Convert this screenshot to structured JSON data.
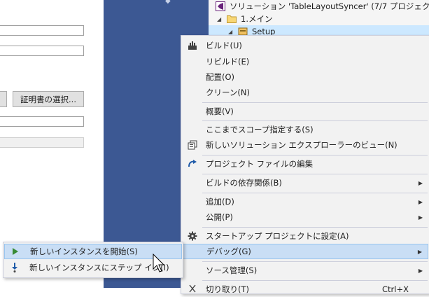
{
  "property_page": {
    "select_cert_label": "証明書の選択..."
  },
  "blue_glyph": "◆",
  "solution_explorer": {
    "solution_label": "ソリューション 'TableLayoutSyncer' (7/7 プロジェクト)",
    "folder_label": "1.メイン",
    "project_label": "Setup"
  },
  "context_menu": {
    "items": [
      {
        "label": "ビルド(U)",
        "icon": "build-icon"
      },
      {
        "label": "リビルド(E)"
      },
      {
        "label": "配置(O)"
      },
      {
        "label": "クリーン(N)"
      },
      {
        "label": "概要(V)"
      },
      {
        "label": "ここまでスコープ指定する(S)"
      },
      {
        "label": "新しいソリューション エクスプローラーのビュー(N)",
        "icon": "new-view-icon"
      },
      {
        "label": "プロジェクト ファイルの編集",
        "icon": "edit-project-icon"
      },
      {
        "label": "ビルドの依存関係(B)",
        "submenu": true
      },
      {
        "label": "追加(D)",
        "submenu": true
      },
      {
        "label": "公開(P)",
        "submenu": true
      },
      {
        "label": "スタートアップ プロジェクトに設定(A)",
        "icon": "gear-icon"
      },
      {
        "label": "デバッグ(G)",
        "submenu": true,
        "highlighted": true
      },
      {
        "label": "ソース管理(S)",
        "submenu": true
      },
      {
        "label": "切り取り(T)",
        "shortcut": "Ctrl+X",
        "icon": "cut-icon"
      }
    ]
  },
  "debug_submenu": {
    "items": [
      {
        "label": "新しいインスタンスを開始(S)",
        "icon": "play-icon",
        "highlighted": true
      },
      {
        "label": "新しいインスタンスにステップ イン(I)",
        "icon": "step-into-icon"
      }
    ]
  },
  "colors": {
    "editor_background": "#3c5893",
    "menu_background": "#f2f2f2",
    "highlight": "#c9def5",
    "selection": "#cce8ff",
    "play_green": "#388a34",
    "step_blue": "#1e5aa8",
    "visual_studio_purple": "#68217a"
  }
}
